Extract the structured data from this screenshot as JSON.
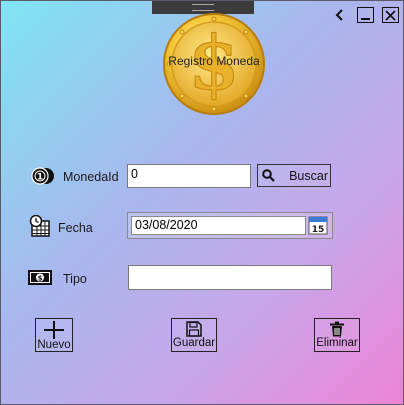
{
  "window": {
    "controls": [
      "back-chevron",
      "minimize",
      "close"
    ]
  },
  "header": {
    "logo_text": "Registro Moneda"
  },
  "form": {
    "moneda_id": {
      "label": "MonedaId",
      "value": "0"
    },
    "buscar_label": "Buscar",
    "fecha": {
      "label": "Fecha",
      "value": "03/08/2020",
      "calendar_day": "15"
    },
    "tipo": {
      "label": "Tipo",
      "value": ""
    }
  },
  "actions": {
    "nuevo": "Nuevo",
    "guardar": "Guardar",
    "eliminar": "Eliminar"
  },
  "colors": {
    "gradient_start": "#7ee6f3",
    "gradient_end": "#ee84d6",
    "coin_gold": "#f2c230"
  }
}
